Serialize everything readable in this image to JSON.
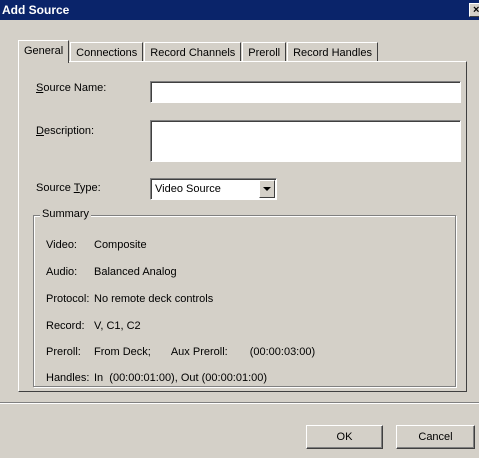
{
  "window": {
    "title": "Add Source",
    "close_symbol": "×"
  },
  "tabs": [
    {
      "label": "General",
      "active": true
    },
    {
      "label": "Connections",
      "active": false
    },
    {
      "label": "Record Channels",
      "active": false
    },
    {
      "label": "Preroll",
      "active": false
    },
    {
      "label": "Record Handles",
      "active": false
    }
  ],
  "form": {
    "source_name": {
      "accel": "S",
      "rest": "ource Name:",
      "value": ""
    },
    "description": {
      "accel": "D",
      "rest": "escription:",
      "value": ""
    },
    "source_type": {
      "prefix": "Source ",
      "accel": "T",
      "rest": "ype:",
      "selected": "Video Source"
    }
  },
  "summary": {
    "title": "Summary",
    "video": {
      "label": "Video:",
      "value": "Composite"
    },
    "audio": {
      "label": "Audio:",
      "value": "Balanced Analog"
    },
    "protocol": {
      "label": "Protocol:",
      "value": "No remote deck controls"
    },
    "record": {
      "label": "Record:",
      "value": "V, C1, C2"
    },
    "preroll": {
      "label": "Preroll:",
      "value": "From Deck;",
      "aux_label": "Aux Preroll:",
      "aux_value": "(00:00:03:00)"
    },
    "handles": {
      "label": "Handles:",
      "value": "In  (00:00:01:00), Out (00:00:01:00)"
    }
  },
  "buttons": {
    "ok": "OK",
    "cancel": "Cancel"
  }
}
